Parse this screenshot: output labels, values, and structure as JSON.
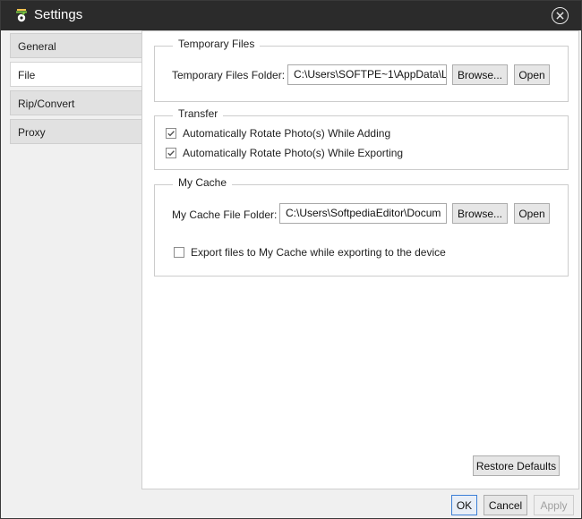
{
  "window": {
    "title": "Settings"
  },
  "sidebar": {
    "tabs": [
      {
        "label": "General"
      },
      {
        "label": "File"
      },
      {
        "label": "Rip/Convert"
      },
      {
        "label": "Proxy"
      }
    ],
    "active": "File"
  },
  "temporary_files": {
    "group_title": "Temporary Files",
    "folder_label": "Temporary Files Folder:",
    "folder_value": "C:\\Users\\SOFTPE~1\\AppData\\L",
    "browse_label": "Browse...",
    "open_label": "Open"
  },
  "transfer": {
    "group_title": "Transfer",
    "options": [
      {
        "label": "Automatically Rotate Photo(s) While Adding",
        "checked": true
      },
      {
        "label": "Automatically Rotate Photo(s) While Exporting",
        "checked": true
      }
    ]
  },
  "my_cache": {
    "group_title": "My Cache",
    "folder_label": "My Cache File Folder:",
    "folder_value": "C:\\Users\\SoftpediaEditor\\Docum",
    "browse_label": "Browse...",
    "open_label": "Open",
    "export_option": {
      "label": "Export files to My Cache while exporting to the device",
      "checked": false
    }
  },
  "restore_defaults_label": "Restore Defaults",
  "footer": {
    "ok_label": "OK",
    "cancel_label": "Cancel",
    "apply_label": "Apply"
  },
  "colors": {
    "titlebar": "#2b2b2b",
    "accent": "#3c7fd6"
  },
  "icons": {
    "app": "app-logo-icon",
    "close": "close-circle-icon",
    "check": "checkmark-icon"
  }
}
